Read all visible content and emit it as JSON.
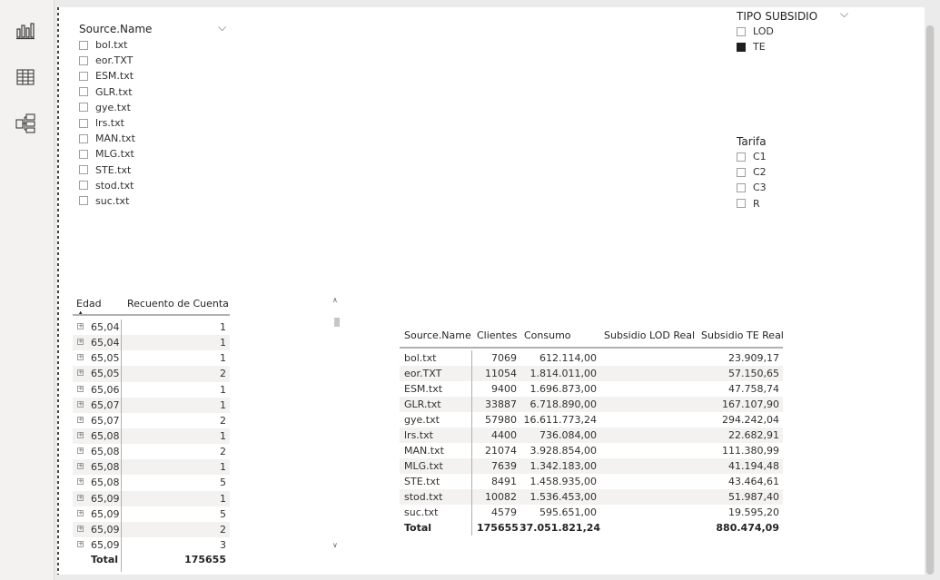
{
  "nav": {
    "items": [
      {
        "name": "report-view-icon"
      },
      {
        "name": "data-view-icon"
      },
      {
        "name": "model-view-icon"
      }
    ]
  },
  "slicer_source": {
    "title": "Source.Name",
    "items": [
      "bol.txt",
      "eor.TXT",
      "ESM.txt",
      "GLR.txt",
      "gye.txt",
      "lrs.txt",
      "MAN.txt",
      "MLG.txt",
      "STE.txt",
      "stod.txt",
      "suc.txt"
    ]
  },
  "slicer_tipo": {
    "title": "TIPO SUBSIDIO",
    "items": [
      {
        "label": "LOD",
        "checked": false
      },
      {
        "label": "TE",
        "checked": true
      }
    ]
  },
  "slicer_tarifa": {
    "title": "Tarifa",
    "items": [
      "C1",
      "C2",
      "C3",
      "R"
    ]
  },
  "edad_table": {
    "headers": [
      "Edad",
      "Recuento de Cuenta"
    ],
    "rows": [
      [
        "65,04",
        "1"
      ],
      [
        "65,04",
        "1"
      ],
      [
        "65,05",
        "1"
      ],
      [
        "65,05",
        "2"
      ],
      [
        "65,06",
        "1"
      ],
      [
        "65,07",
        "1"
      ],
      [
        "65,07",
        "2"
      ],
      [
        "65,08",
        "1"
      ],
      [
        "65,08",
        "2"
      ],
      [
        "65,08",
        "1"
      ],
      [
        "65,08",
        "5"
      ],
      [
        "65,09",
        "1"
      ],
      [
        "65,09",
        "5"
      ],
      [
        "65,09",
        "2"
      ],
      [
        "65,09",
        "3"
      ]
    ],
    "total_label": "Total",
    "total_value": "175655"
  },
  "main_table": {
    "headers": [
      "Source.Name",
      "Clientes",
      "Consumo",
      "Subsidio LOD Real",
      "Subsidio TE Real"
    ],
    "rows": [
      [
        "bol.txt",
        "7069",
        "612.114,00",
        "",
        "23.909,17"
      ],
      [
        "eor.TXT",
        "11054",
        "1.814.011,00",
        "",
        "57.150,65"
      ],
      [
        "ESM.txt",
        "9400",
        "1.696.873,00",
        "",
        "47.758,74"
      ],
      [
        "GLR.txt",
        "33887",
        "6.718.890,00",
        "",
        "167.107,90"
      ],
      [
        "gye.txt",
        "57980",
        "16.611.773,24",
        "",
        "294.242,04"
      ],
      [
        "lrs.txt",
        "4400",
        "736.084,00",
        "",
        "22.682,91"
      ],
      [
        "MAN.txt",
        "21074",
        "3.928.854,00",
        "",
        "111.380,99"
      ],
      [
        "MLG.txt",
        "7639",
        "1.342.183,00",
        "",
        "41.194,48"
      ],
      [
        "STE.txt",
        "8491",
        "1.458.935,00",
        "",
        "43.464,61"
      ],
      [
        "stod.txt",
        "10082",
        "1.536.453,00",
        "",
        "51.987,40"
      ],
      [
        "suc.txt",
        "4579",
        "595.651,00",
        "",
        "19.595,20"
      ]
    ],
    "total": [
      "Total",
      "175655",
      "37.051.821,24",
      "",
      "880.474,09"
    ]
  },
  "colors": {
    "accent_underline": "#b3b0ad",
    "row_alt": "#f3f2f1",
    "checked": "#1f1f1f"
  }
}
